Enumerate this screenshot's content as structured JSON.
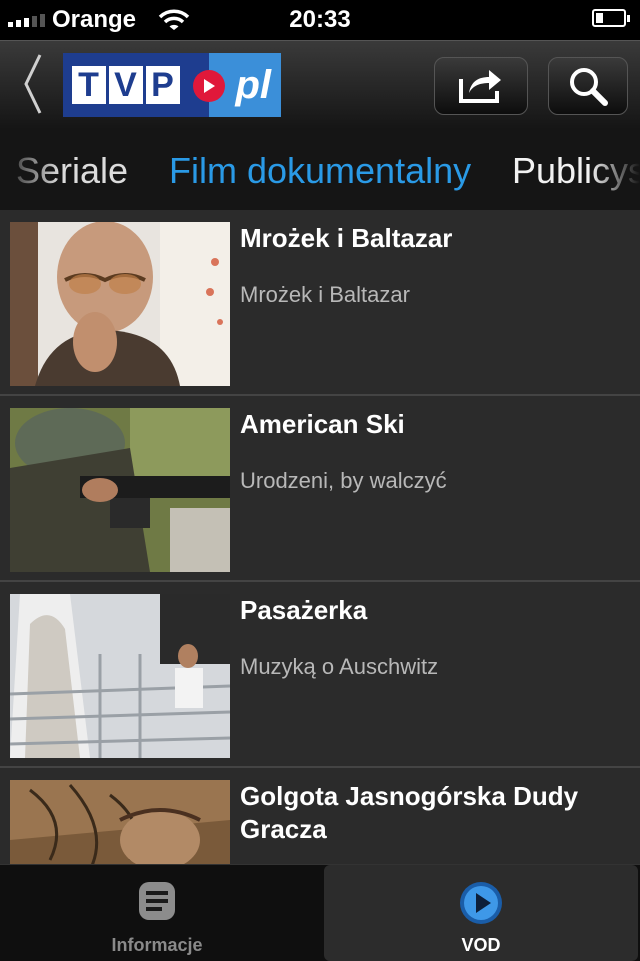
{
  "status_bar": {
    "carrier": "Orange",
    "time": "20:33"
  },
  "header": {
    "logo_letters": [
      "T",
      "V",
      "P"
    ],
    "logo_suffix": "pl"
  },
  "categories": {
    "previous": "Seriale",
    "active": "Film dokumentalny",
    "next": "Publicys"
  },
  "items": [
    {
      "title": "Mrożek i Baltazar",
      "subtitle": "Mrożek i Baltazar"
    },
    {
      "title": "American Ski",
      "subtitle": "Urodzeni, by walczyć"
    },
    {
      "title": "Pasażerka",
      "subtitle": "Muzyką o Auschwitz"
    },
    {
      "title": "Golgota Jasnogórska Dudy Gracza",
      "subtitle": ""
    }
  ],
  "tabs": [
    {
      "label": "Informacje",
      "icon": "document-icon",
      "selected": false
    },
    {
      "label": "VOD",
      "icon": "play-icon",
      "selected": true
    }
  ],
  "colors": {
    "accent": "#2a9ae6",
    "logo_blue": "#1e3d8f",
    "logo_red": "#e0183a",
    "logo_light_blue": "#3b8fd9"
  }
}
